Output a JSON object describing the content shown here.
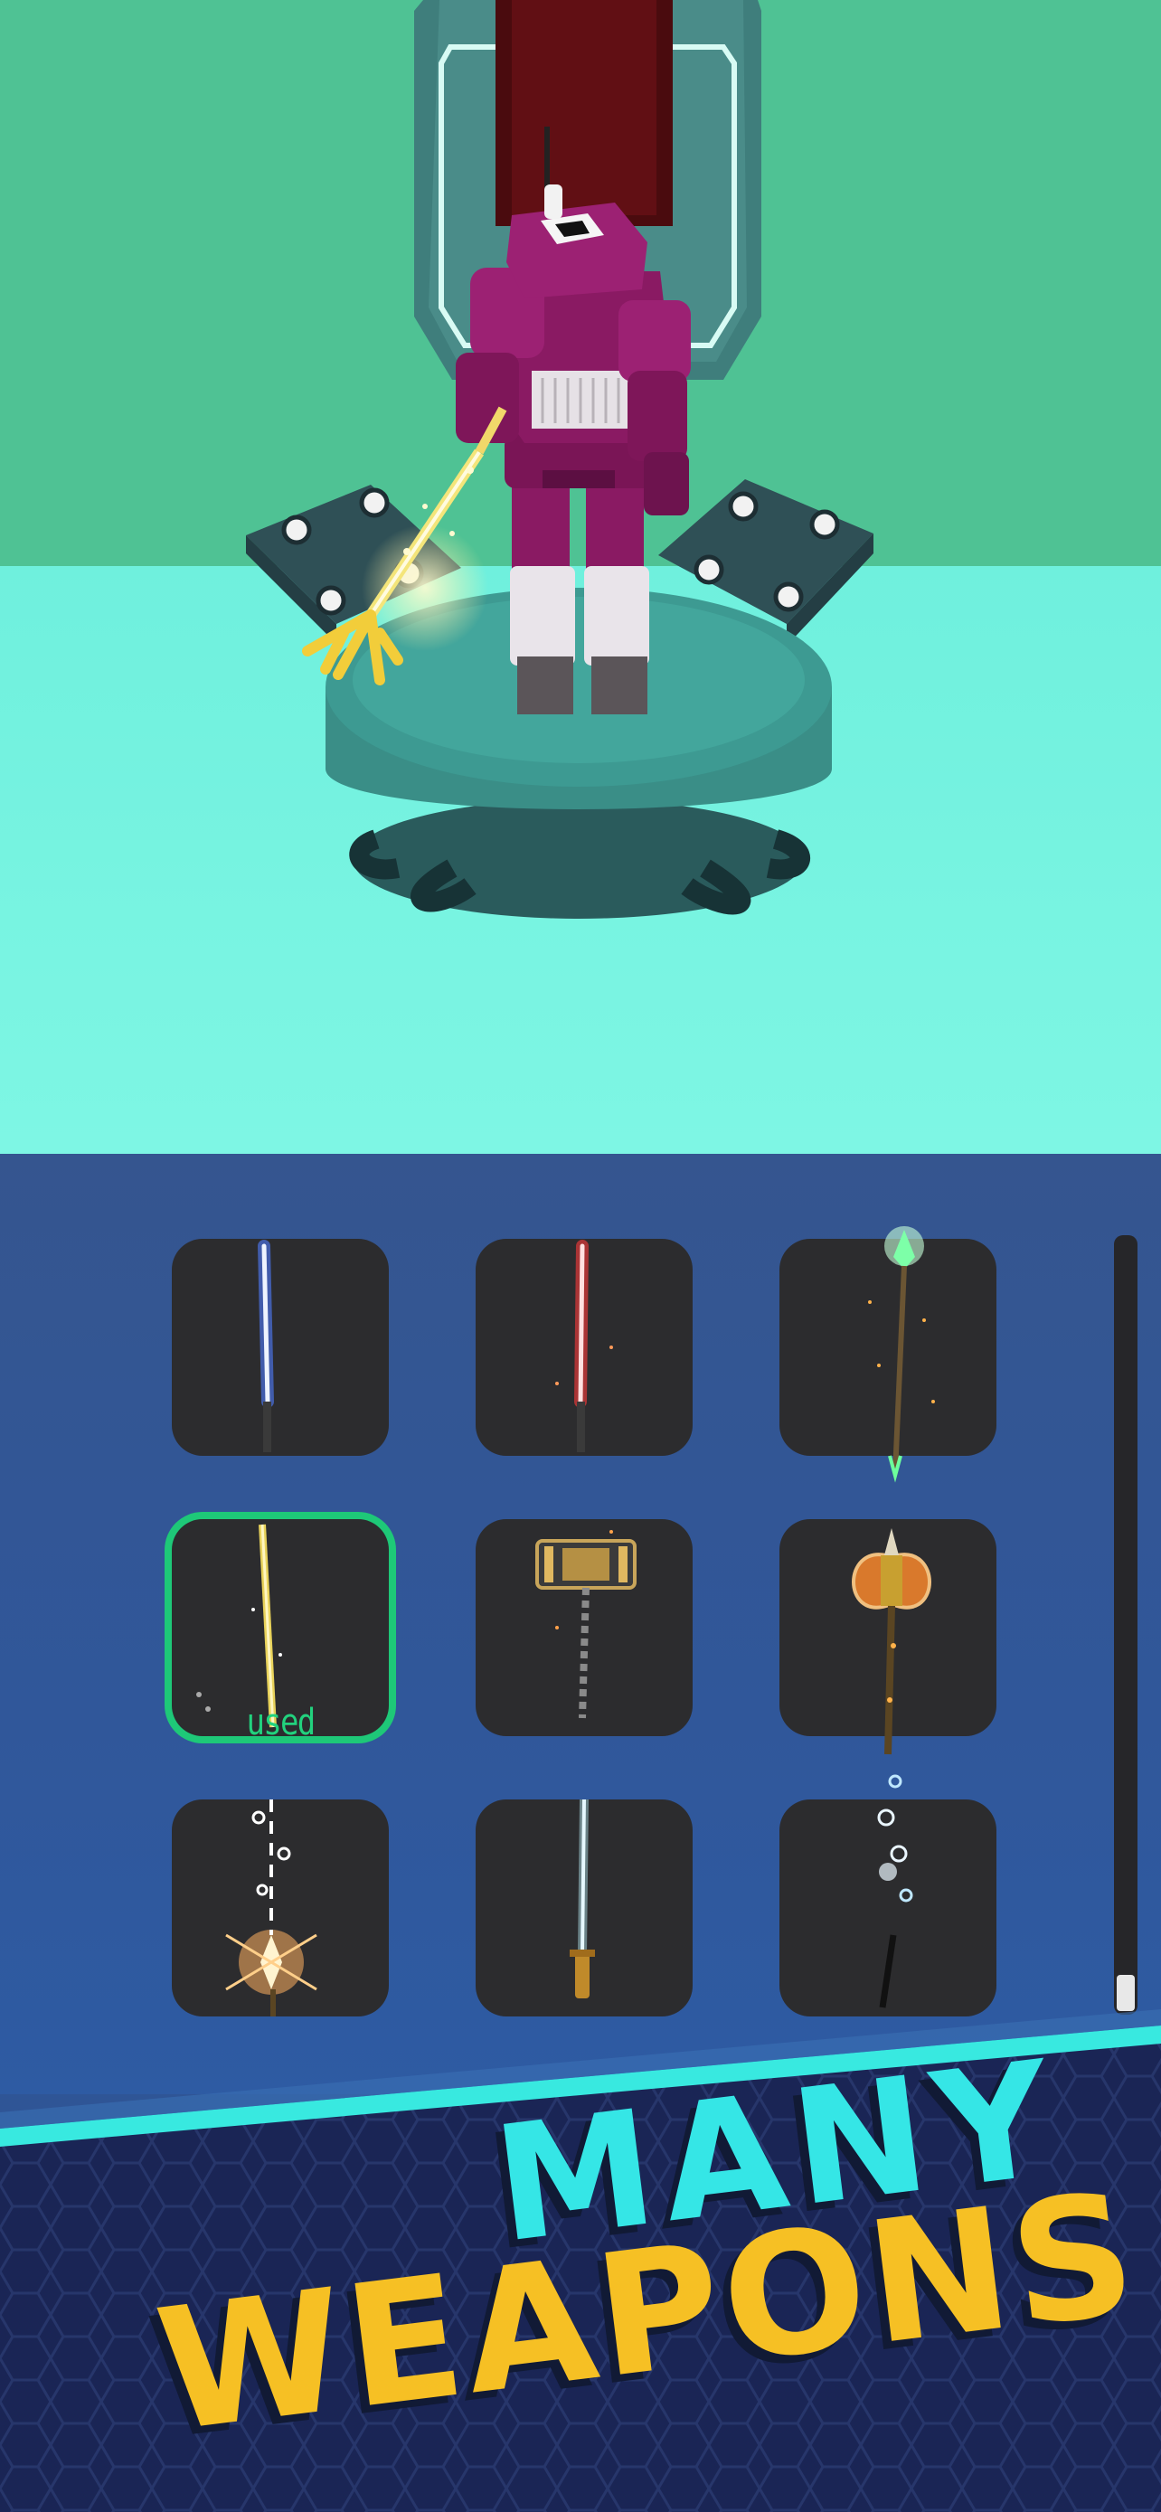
{
  "scene": {
    "description_icon": "robot-on-pedestal",
    "colors": {
      "wall": "#4fc294",
      "floor": "#7ef3df",
      "pedestal": "#3a8e87",
      "robot": "#8a1a63"
    }
  },
  "inventory": {
    "slots": [
      {
        "weapon_icon": "blue-lightsaber-icon",
        "selected": false,
        "status": ""
      },
      {
        "weapon_icon": "red-lightsaber-icon",
        "selected": false,
        "status": ""
      },
      {
        "weapon_icon": "green-spear-icon",
        "selected": false,
        "status": ""
      },
      {
        "weapon_icon": "golden-trident-icon",
        "selected": true,
        "status": "used"
      },
      {
        "weapon_icon": "war-hammer-icon",
        "selected": false,
        "status": ""
      },
      {
        "weapon_icon": "battle-axe-icon",
        "selected": false,
        "status": ""
      },
      {
        "weapon_icon": "flame-spear-icon",
        "selected": false,
        "status": ""
      },
      {
        "weapon_icon": "ice-sword-icon",
        "selected": false,
        "status": ""
      },
      {
        "weapon_icon": "spirit-staff-icon",
        "selected": false,
        "status": ""
      }
    ],
    "accent_color": "#1ec878"
  },
  "banner": {
    "line1": "MANY",
    "line2": "WEAPONS",
    "line1_color": "#35e6e6",
    "line2_color": "#f6c024"
  }
}
